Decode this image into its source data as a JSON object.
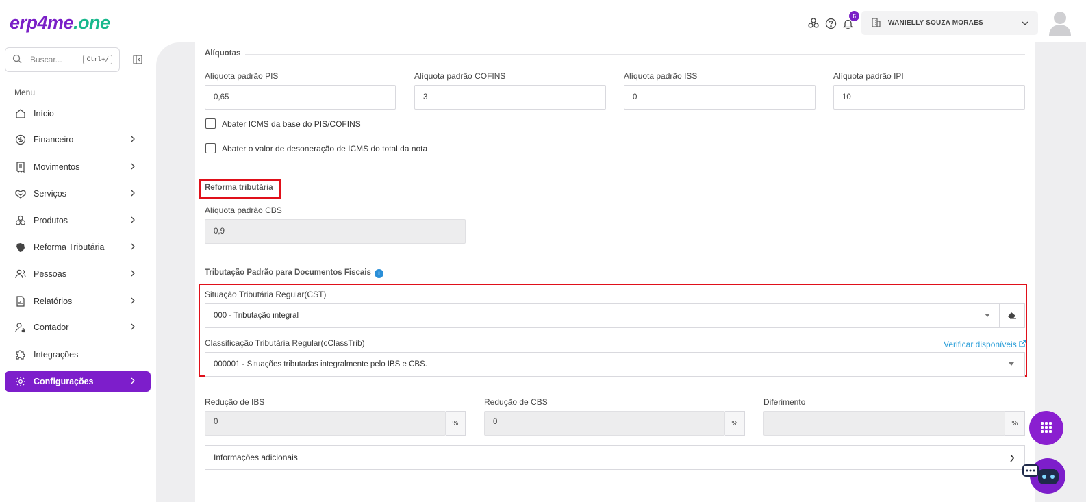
{
  "header": {
    "logo_part1": "erp4me",
    "logo_part2": ".one",
    "notification_count": "6",
    "company_name": "WANIELLY SOUZA MORAES"
  },
  "sidebar": {
    "search_placeholder": "Buscar...",
    "search_shortcut": "Ctrl+/",
    "menu_title": "Menu",
    "items": [
      {
        "label": "Início",
        "icon": "home-icon",
        "has_chevron": false
      },
      {
        "label": "Financeiro",
        "icon": "dollar-icon",
        "has_chevron": true
      },
      {
        "label": "Movimentos",
        "icon": "receipt-icon",
        "has_chevron": true
      },
      {
        "label": "Serviços",
        "icon": "handshake-icon",
        "has_chevron": true
      },
      {
        "label": "Produtos",
        "icon": "boxes-icon",
        "has_chevron": true
      },
      {
        "label": "Reforma Tributária",
        "icon": "map-icon",
        "has_chevron": true
      },
      {
        "label": "Pessoas",
        "icon": "people-icon",
        "has_chevron": true
      },
      {
        "label": "Relatórios",
        "icon": "report-icon",
        "has_chevron": true
      },
      {
        "label": "Contador",
        "icon": "accountant-icon",
        "has_chevron": true
      },
      {
        "label": "Integrações",
        "icon": "puzzle-icon",
        "has_chevron": false
      },
      {
        "label": "Configurações",
        "icon": "gear-icon",
        "has_chevron": true,
        "active": true
      }
    ]
  },
  "aliquotas": {
    "title": "Alíquotas",
    "pis_label": "Alíquota padrão PIS",
    "pis_value": "0,65",
    "cofins_label": "Alíquota padrão COFINS",
    "cofins_value": "3",
    "iss_label": "Alíquota padrão ISS",
    "iss_value": "0",
    "ipi_label": "Alíquota padrão IPI",
    "ipi_value": "10",
    "check1_label": "Abater ICMS da base do PIS/COFINS",
    "check2_label": "Abater o valor de desoneração de ICMS do total da nota"
  },
  "reforma": {
    "title": "Reforma tributária",
    "cbs_label": "Alíquota padrão CBS",
    "cbs_value": "0,9"
  },
  "tributacao": {
    "title": "Tributação Padrão para Documentos Fiscais",
    "cst_label": "Situação Tributária Regular(CST)",
    "cst_value": "000 - Tributação integral",
    "cclass_label": "Classificação Tributária Regular(cClassTrib)",
    "cclass_value": "000001 - Situações tributadas integralmente pelo IBS e CBS.",
    "verify_link": "Verificar disponíveis"
  },
  "reducoes": {
    "ibs_label": "Redução de IBS",
    "ibs_value": "0",
    "cbs_label": "Redução de CBS",
    "cbs_value": "0",
    "dif_label": "Diferimento",
    "dif_value": "",
    "percent": "%"
  },
  "accordion_label": "Informações adicionais",
  "colors": {
    "brand_purple": "#7d1ecb",
    "brand_green": "#18b88c",
    "highlight_red": "#e0101a",
    "link_blue": "#2a9ed8"
  }
}
